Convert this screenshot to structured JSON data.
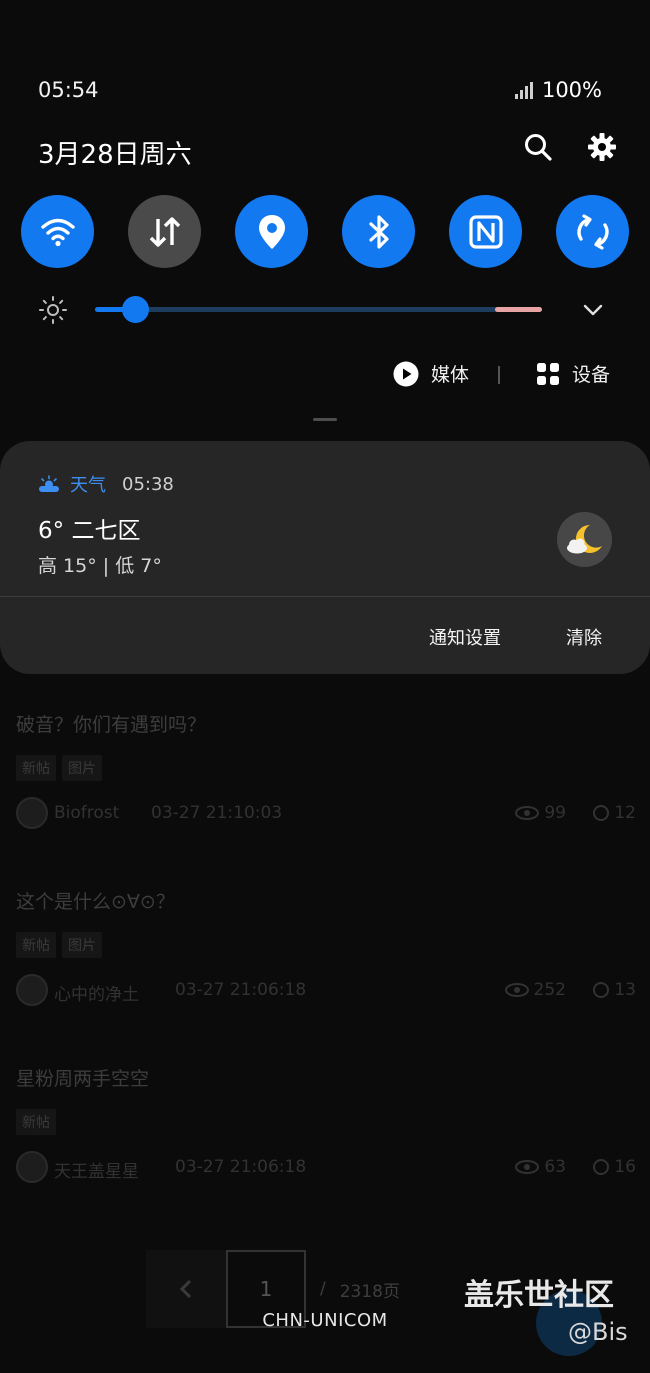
{
  "status_bar": {
    "time": "05:54",
    "battery": "100%",
    "date": "3月28日周六"
  },
  "quick_toggles": [
    {
      "name": "wifi",
      "state": "on"
    },
    {
      "name": "mobile-data",
      "state": "off"
    },
    {
      "name": "location",
      "state": "on"
    },
    {
      "name": "bluetooth",
      "state": "on"
    },
    {
      "name": "nfc",
      "state": "on"
    },
    {
      "name": "auto-rotate",
      "state": "on"
    }
  ],
  "brightness": {
    "level": 0.09
  },
  "media_label": "媒体",
  "devices_label": "设备",
  "notification": {
    "app_name": "天气",
    "time": "05:38",
    "temp_location": "6° 二七区",
    "hi_lo": "高 15° | 低 7°",
    "action_settings": "通知设置",
    "action_clear": "清除"
  },
  "background": {
    "posts": [
      {
        "title": "破音？你们有遇到吗？",
        "tags": [
          "新帖",
          "图片"
        ],
        "author": "Biofrost",
        "time": "03-27 21:10:03",
        "views": "99",
        "replies": "12"
      },
      {
        "title": "这个是什么⊙∀⊙？",
        "tags": [
          "新帖",
          "图片"
        ],
        "author": "心中的净土",
        "time": "03-27 21:06:18",
        "views": "252",
        "replies": "13"
      },
      {
        "title": "星粉周两手空空",
        "tags": [
          "新帖"
        ],
        "author": "天王盖星星",
        "time": "03-27 21:06:18",
        "views": "63",
        "replies": "16"
      }
    ],
    "pager": {
      "current": "1",
      "separator": "/",
      "total": "2318页"
    }
  },
  "carrier": "CHN-UNICOM",
  "watermark": {
    "line1": "盖乐世社区",
    "line2": "@Bis"
  },
  "colors": {
    "accent": "#1379f0",
    "card": "#262626",
    "toggle_off": "#4a4a4a",
    "weather_app": "#3d8ef0"
  }
}
